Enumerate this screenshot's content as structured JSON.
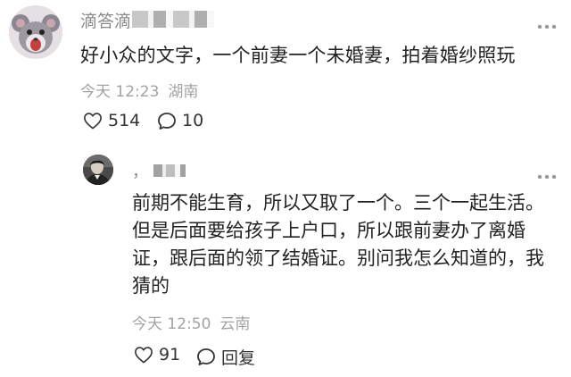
{
  "comment": {
    "username_visible": "滴答滴",
    "text": "好小众的文字，一个前妻一个未婚妻，拍着婚纱照玩",
    "time": "今天 12:23",
    "location": "湖南",
    "like_count": "514",
    "reply_count": "10",
    "more_icon": "more-dots-icon"
  },
  "reply": {
    "username_visible": "，",
    "text": "前期不能生育，所以又取了一个。三个一起生活。但是后面要给孩子上户口，所以跟前妻办了离婚证，跟后面的领了结婚证。别问我怎么知道的，我猜的",
    "time": "今天 12:50",
    "location": "云南",
    "like_count": "91",
    "reply_label": "回复",
    "more_icon": "more-dots-icon"
  },
  "icons": {
    "like": "heart-outline-icon",
    "reply": "speech-bubble-icon"
  }
}
